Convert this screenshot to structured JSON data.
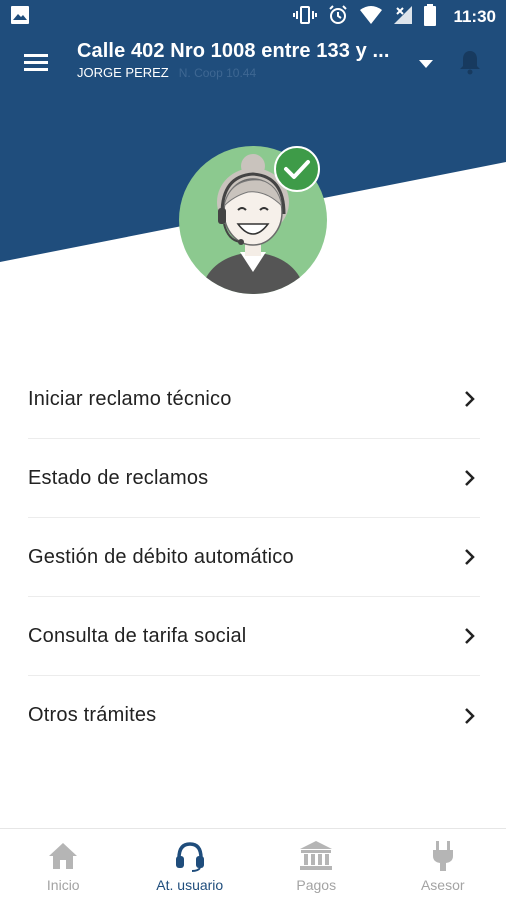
{
  "status_bar": {
    "time": "11:30",
    "icons": [
      "image-icon",
      "vibrate-icon",
      "alarm-icon",
      "wifi-icon",
      "signal-icon",
      "battery-icon"
    ]
  },
  "header": {
    "address": "Calle 402 Nro 1008 entre 133 y ...",
    "user_name": "JORGE PEREZ",
    "user_extra": "N. Coop 10.44",
    "menu_icon": "hamburger-icon",
    "dropdown_icon": "caret-down-icon",
    "bell_icon": "bell-icon",
    "avatar_icon": "support-agent-avatar",
    "badge_icon": "check-badge-icon"
  },
  "menu": {
    "items": [
      {
        "label": "Iniciar reclamo técnico"
      },
      {
        "label": "Estado de reclamos"
      },
      {
        "label": "Gestión de débito automático"
      },
      {
        "label": "Consulta de tarifa social"
      },
      {
        "label": "Otros trámites"
      }
    ]
  },
  "bottom_nav": {
    "items": [
      {
        "label": "Inicio",
        "icon": "home-icon",
        "active": false
      },
      {
        "label": "At. usuario",
        "icon": "headset-icon",
        "active": true
      },
      {
        "label": "Pagos",
        "icon": "bank-icon",
        "active": false
      },
      {
        "label": "Asesor",
        "icon": "plug-icon",
        "active": false
      }
    ]
  },
  "colors": {
    "primary": "#1f4d7c",
    "avatar_bg": "#8cc98f",
    "check_badge": "#3e9b48",
    "inactive": "#a3a3a3"
  }
}
